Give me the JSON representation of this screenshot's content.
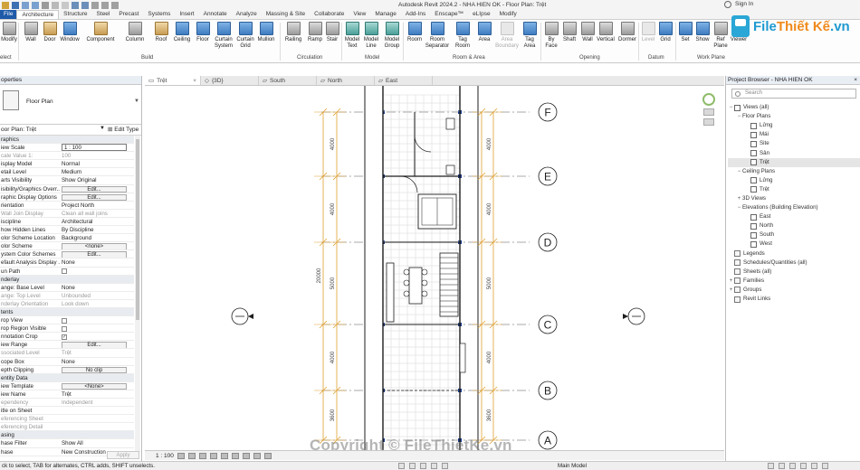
{
  "titlebar": {
    "title": "Autodesk Revit 2024.2 - NHA HIEN OK - Floor Plan: Trệt",
    "signin": "Sign In"
  },
  "ribbon": {
    "file_tab": "File",
    "tabs": [
      "Architecture",
      "Structure",
      "Steel",
      "Precast",
      "Systems",
      "Insert",
      "Annotate",
      "Analyze",
      "Massing & Site",
      "Collaborate",
      "View",
      "Manage",
      "Add-Ins",
      "Enscape™",
      "eLIpse",
      "Modify"
    ],
    "active_tab": "Architecture",
    "buttons": {
      "modify": "Modify",
      "wall": "Wall",
      "door": "Door",
      "window": "Window",
      "component": "Component",
      "column": "Column",
      "roof": "Roof",
      "ceiling": "Ceiling",
      "floor": "Floor",
      "curtain_system": "Curtain System",
      "curtain_grid": "Curtain Grid",
      "mullion": "Mullion",
      "railing": "Railing",
      "ramp": "Ramp",
      "stair": "Stair",
      "model_text": "Model Text",
      "model_line": "Model Line",
      "model_group": "Model Group",
      "room": "Room",
      "room_separator": "Room Separator",
      "tag_room": "Tag Room",
      "area": "Area",
      "area_boundary": "Area Boundary",
      "tag_area": "Tag Area",
      "by_face": "By Face",
      "shaft": "Shaft",
      "wall_opening": "Wall",
      "vertical": "Vertical",
      "dormer": "Dormer",
      "level": "Level",
      "grid": "Grid",
      "set": "Set",
      "show": "Show",
      "ref_plane": "Ref Plane",
      "viewer": "Viewer"
    },
    "groups": {
      "select": "elect",
      "build": "Build",
      "circulation": "Circulation",
      "model": "Model",
      "room_area": "Room & Area",
      "opening": "Opening",
      "datum": "Datum",
      "work_plane": "Work Plane"
    }
  },
  "logo": {
    "part1": "File",
    "part2": "Thiết Kế",
    "part3": ".vn"
  },
  "properties": {
    "header": "operties",
    "type_name": "Floor Plan",
    "instance_selector": "oor Plan: Trệt",
    "edit_type": "Edit Type",
    "rows": [
      {
        "k": "raphics",
        "v": "",
        "kind": "section"
      },
      {
        "k": "iew Scale",
        "v": "1 : 100",
        "kind": "field"
      },
      {
        "k": "cale Value   1:",
        "v": "100",
        "kind": "grey"
      },
      {
        "k": "isplay Model",
        "v": "Normal"
      },
      {
        "k": "etail Level",
        "v": "Medium"
      },
      {
        "k": "arts Visibility",
        "v": "Show Original"
      },
      {
        "k": "isibility/Graphics Overr...",
        "v": "Edit...",
        "kind": "button"
      },
      {
        "k": "raphic Display Options",
        "v": "Edit...",
        "kind": "button"
      },
      {
        "k": "rientation",
        "v": "Project North"
      },
      {
        "k": "Wall Join Display",
        "v": "Clean all wall joins",
        "kind": "grey"
      },
      {
        "k": "iscipline",
        "v": "Architectural"
      },
      {
        "k": "how Hidden Lines",
        "v": "By Discipline"
      },
      {
        "k": "olor Scheme Location",
        "v": "Background"
      },
      {
        "k": "olor Scheme",
        "v": "<none>",
        "kind": "button"
      },
      {
        "k": "ystem Color Schemes",
        "v": "Edit...",
        "kind": "button"
      },
      {
        "k": "efault Analysis Display ...",
        "v": "None"
      },
      {
        "k": "un Path",
        "v": "",
        "kind": "check"
      },
      {
        "k": "nderlay",
        "v": "",
        "kind": "section"
      },
      {
        "k": "ange: Base Level",
        "v": "None"
      },
      {
        "k": "ange: Top Level",
        "v": "Unbounded",
        "kind": "grey"
      },
      {
        "k": "nderlay Orientation",
        "v": "Look down",
        "kind": "grey"
      },
      {
        "k": "tents",
        "v": "",
        "kind": "section"
      },
      {
        "k": "rop View",
        "v": "",
        "kind": "check"
      },
      {
        "k": "rop Region Visible",
        "v": "",
        "kind": "check"
      },
      {
        "k": "nnotation Crop",
        "v": "✓",
        "kind": "check"
      },
      {
        "k": "iew Range",
        "v": "Edit...",
        "kind": "button"
      },
      {
        "k": "ssociated Level",
        "v": "Trệt",
        "kind": "grey"
      },
      {
        "k": "cope Box",
        "v": "None"
      },
      {
        "k": "epth Clipping",
        "v": "No clip",
        "kind": "button"
      },
      {
        "k": "entity Data",
        "v": "",
        "kind": "section"
      },
      {
        "k": "iew Template",
        "v": "<None>",
        "kind": "button"
      },
      {
        "k": "iew Name",
        "v": "Trệt"
      },
      {
        "k": "ependency",
        "v": "Independent",
        "kind": "grey"
      },
      {
        "k": "itle on Sheet",
        "v": ""
      },
      {
        "k": "eferencing Sheet",
        "v": "",
        "kind": "grey"
      },
      {
        "k": "eferencing Detail",
        "v": "",
        "kind": "grey"
      },
      {
        "k": "asing",
        "v": "",
        "kind": "section"
      },
      {
        "k": "hase Filter",
        "v": "Show All"
      },
      {
        "k": "hase",
        "v": "New Construction"
      }
    ],
    "apply": "Apply"
  },
  "view_tabs": [
    {
      "label": "Trệt",
      "active": true
    },
    {
      "label": "{3D}",
      "active": false
    },
    {
      "label": "South",
      "active": false
    },
    {
      "label": "North",
      "active": false
    },
    {
      "label": "East",
      "active": false
    }
  ],
  "drawing": {
    "grid_bubbles": [
      "F",
      "E",
      "D",
      "C",
      "B",
      "A"
    ],
    "dim_values_left": [
      "4000",
      "4000",
      "5000",
      "4000",
      "3600"
    ],
    "dim_total": "20000",
    "dim_values_right": [
      "4000",
      "4000",
      "5000",
      "4000",
      "3600"
    ]
  },
  "viewbar": {
    "scale": "1 : 100"
  },
  "watermark": "Copyright © FileThietKe.vn",
  "browser": {
    "header": "Project Browser - NHA HIEN OK",
    "search_placeholder": "Search",
    "tree": [
      {
        "label": "Views (all)",
        "level": 0,
        "toggle": "−",
        "icon": "view"
      },
      {
        "label": "Floor Plans",
        "level": 1,
        "toggle": "−",
        "icon": "none"
      },
      {
        "label": "Lửng",
        "level": 2,
        "toggle": "",
        "icon": "view"
      },
      {
        "label": "Mái",
        "level": 2,
        "toggle": "",
        "icon": "view"
      },
      {
        "label": "Site",
        "level": 2,
        "toggle": "",
        "icon": "view"
      },
      {
        "label": "Sân",
        "level": 2,
        "toggle": "",
        "icon": "view"
      },
      {
        "label": "Trệt",
        "level": 2,
        "toggle": "",
        "icon": "view",
        "selected": true
      },
      {
        "label": "Ceiling Plans",
        "level": 1,
        "toggle": "−",
        "icon": "none"
      },
      {
        "label": "Lửng",
        "level": 2,
        "toggle": "",
        "icon": "view"
      },
      {
        "label": "Trệt",
        "level": 2,
        "toggle": "",
        "icon": "view"
      },
      {
        "label": "3D Views",
        "level": 1,
        "toggle": "+",
        "icon": "none"
      },
      {
        "label": "Elevations (Building Elevation)",
        "level": 1,
        "toggle": "−",
        "icon": "none"
      },
      {
        "label": "East",
        "level": 2,
        "toggle": "",
        "icon": "view"
      },
      {
        "label": "North",
        "level": 2,
        "toggle": "",
        "icon": "view"
      },
      {
        "label": "South",
        "level": 2,
        "toggle": "",
        "icon": "view"
      },
      {
        "label": "West",
        "level": 2,
        "toggle": "",
        "icon": "view"
      },
      {
        "label": "Legends",
        "level": 0,
        "toggle": "",
        "icon": "box"
      },
      {
        "label": "Schedules/Quantities (all)",
        "level": 0,
        "toggle": "",
        "icon": "box"
      },
      {
        "label": "Sheets (all)",
        "level": 0,
        "toggle": "",
        "icon": "box"
      },
      {
        "label": "Families",
        "level": 0,
        "toggle": "+",
        "icon": "box"
      },
      {
        "label": "Groups",
        "level": 0,
        "toggle": "+",
        "icon": "box"
      },
      {
        "label": "Revit Links",
        "level": 0,
        "toggle": "",
        "icon": "box"
      }
    ]
  },
  "statusbar": {
    "hint": "ck to select, TAB for alternates, CTRL adds, SHIFT unselects.",
    "model": "Main Model"
  }
}
